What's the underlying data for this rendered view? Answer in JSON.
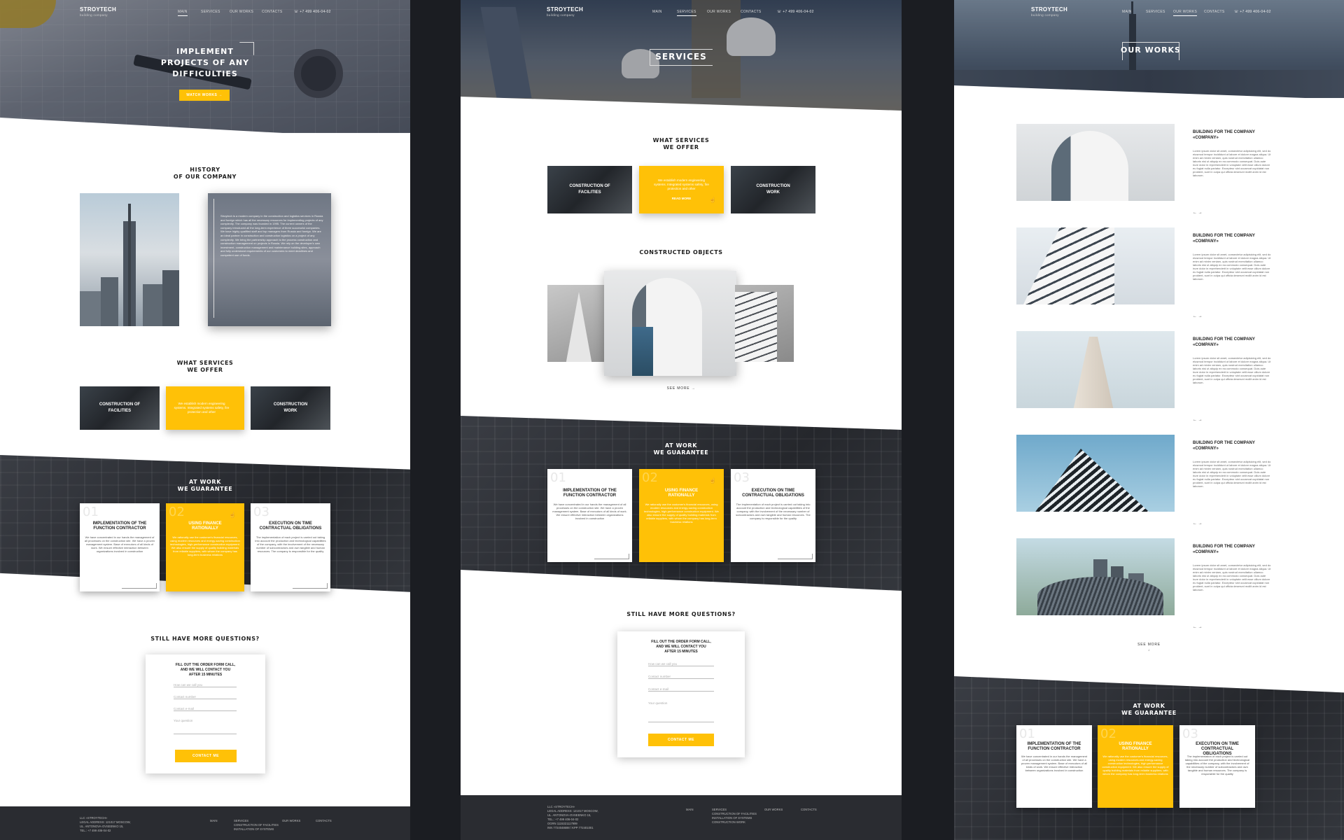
{
  "brand": {
    "name": "STROYTECH",
    "tagline": "building company"
  },
  "nav": {
    "items": [
      "MAIN",
      "SERVICES",
      "OUR WORKS",
      "CONTACTS"
    ],
    "phone": "+7 499 406-04-02"
  },
  "page1": {
    "hero_title": [
      "IMPLEMENT",
      "PROJECTS OF ANY",
      "DIFFICULTIES"
    ],
    "hero_button": "WATCH WORKS",
    "history_title": [
      "HISTORY",
      "OF OUR COMPANY"
    ],
    "history_text": "Stroytech is a modern company in the construction and logistics services in Russia and foreign which has all the necessary resources for implementing projects of any complexity. The company was founded in 1995. The current owners of the company introduced all the long-term experience of three successful companies. We have highly qualified staff and top managers from Russia and foreign. We are an ideal partner in construction and construction logistics on a project of any complexity. We bring the partnership approach to the process construction and construction management on projects in Russia. We rely on the developer's own investment, construction management and maintenance building sites, approach and fully understand requirements of our customers to meet deadlines and competent use of funds.",
    "services_title": [
      "WHAT SERVICES",
      "WE OFFER"
    ],
    "guarantee_title": [
      "AT WORK",
      "WE GUARANTEE"
    ],
    "questions_title": "STILL HAVE MORE QUESTIONS?"
  },
  "services": [
    {
      "label": "CONSTRUCTION OF FACILITIES"
    },
    {
      "label": "We establish modern engineering systems. Integrated systems safety, fire protection and other",
      "more": "READ MORE"
    },
    {
      "label": "CONSTRUCTION WORK"
    }
  ],
  "guarantees": [
    {
      "num": "01",
      "title": "IMPLEMENTATION OF THE FUNCTION CONTRACTOR",
      "text": "We have concentrated in our hands the management of all processes on the construction site. We have a proven management system. Base of executors of all kinds of work. We ensure effective interaction between organizations involved in construction"
    },
    {
      "num": "02",
      "title": "USING FINANCE RATIONALLY",
      "text": "We rationally use the customer's financial resources, using modern resources and energy-saving construction technologies, high-performance construction equipment. We also ensure the supply of quality building materials from reliable suppliers, with whom the company has long-term business relations"
    },
    {
      "num": "03",
      "title": "EXECUTION ON TIME CONTRACTUAL OBLIGATIONS",
      "text": "The implementation of each project is carried out taking into account the production and technological capabilities of the company, with the involvement of the necessary number of subcontractors and own tangible and human resources. The company is responsible for the quality"
    }
  ],
  "form": {
    "title": [
      "FILL OUT THE ORDER FORM CALL,",
      "AND WE WILL CONTACT YOU",
      "AFTER 15 MINUTES"
    ],
    "fields": [
      "How can we call you",
      "Contact number",
      "Contact e-mail",
      "Your question"
    ],
    "button": "CONTACT ME"
  },
  "footer": {
    "address": [
      "LLC «STROYTECH»",
      "LEGAL ADDRESS: 121017 MOSCOW,",
      "UL. ANTONOVA-OVSEENKO 15,",
      "TEL.: +7 499 406-04-02",
      "OGRN 1115321117999",
      "INN 7724048698 / KPP 772401001"
    ],
    "main": "MAIN",
    "services": [
      "SERVICES",
      "CONSTRUCTION OF FACILITIES",
      "INSTALLATION OF SYSTEMS",
      "CONSTRUCTION WORK"
    ],
    "works": "OUR WORKS",
    "contacts": "CONTACTS"
  },
  "page2": {
    "hero_title": "SERVICES",
    "services_title": [
      "WHAT SERVICES",
      "WE OFFER"
    ],
    "objects_title": "CONSTRUCTED OBJECTS",
    "see_more": "SEE MORE",
    "guarantee_title": [
      "AT WORK",
      "WE GUARANTEE"
    ],
    "questions_title": "STILL HAVE MORE QUESTIONS?"
  },
  "page3": {
    "hero_title": "OUR WORKS",
    "work_title": [
      "BUILDING FOR THE COMPANY",
      "«COMPANY»"
    ],
    "work_text": "Lorem ipsum dolor sit amet, consectetur adipisicing elit, sed do eiusmod tempor incididunt ut labore et dolore magna aliqua. Ut enim ad minim veniam, quis nostrud exercitation ullamco laboris nisi ut aliquip ex ea commodo consequat. Duis aute irure dolor in reprehenderit in voluptate velit esse cillum dolore eu fugiat nulla pariatur. Excepteur sint occaecat cupidatat non proident, sunt in culpa qui officia deserunt mollit anim id est laborum.",
    "see_more": "SEE MORE",
    "guarantee_title": [
      "AT WORK",
      "WE GUARANTEE"
    ]
  },
  "colors": {
    "accent": "#ffc107",
    "dark": "#2a2c31"
  }
}
